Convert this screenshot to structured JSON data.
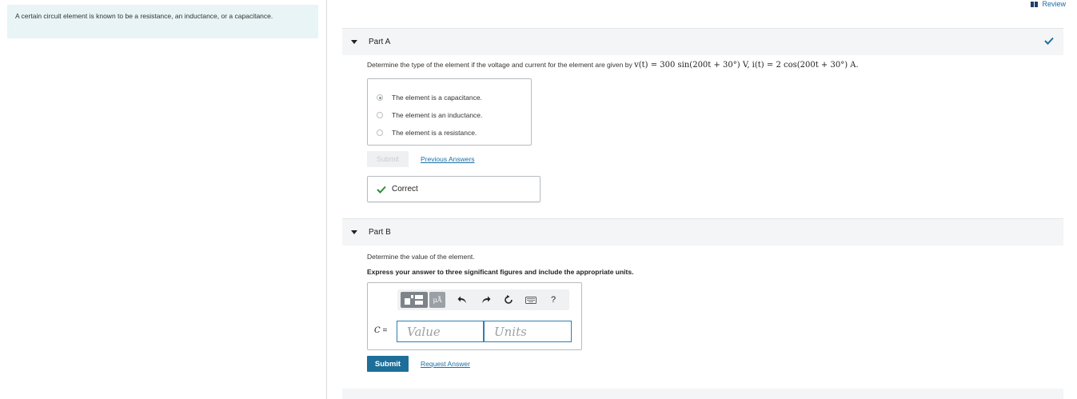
{
  "intro": {
    "text": "A certain circuit element is known to be a resistance, an inductance, or a capacitance."
  },
  "review": {
    "label": "Review",
    "icon": "review-icon"
  },
  "part_a": {
    "title": "Part A",
    "question_prefix": "Determine the type of the element if the voltage and current for the element are given by ",
    "question_math": "v(t) = 300 sin(200t + 30°) V, i(t) = 2 cos(200t + 30°) A.",
    "choices": [
      {
        "label": "The element is a capacitance.",
        "selected": true
      },
      {
        "label": "The element is an inductance.",
        "selected": false
      },
      {
        "label": "The element is a resistance.",
        "selected": false
      }
    ],
    "submit_label": "Submit",
    "previous_answers_label": "Previous Answers",
    "feedback": "Correct"
  },
  "part_b": {
    "title": "Part B",
    "question": "Determine the value of the element.",
    "instruction": "Express your answer to three significant figures and include the appropriate units.",
    "toolbar": {
      "units_label": "μÅ",
      "help_label": "?"
    },
    "variable": "C",
    "equals": "=",
    "value_placeholder": "Value",
    "units_placeholder": "Units",
    "submit_label": "Submit",
    "request_answer_label": "Request Answer"
  },
  "colors": {
    "accent": "#1d6f99",
    "link": "#1b6ea6",
    "correct_green": "#2e8b3a",
    "intro_bg": "#e8f4f6"
  }
}
